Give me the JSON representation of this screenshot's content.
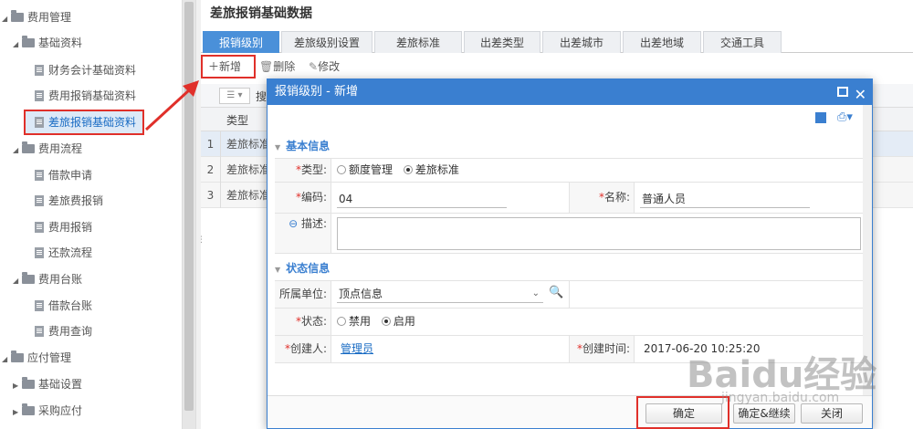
{
  "sidebar": {
    "items": [
      {
        "label": "费用管理"
      },
      {
        "label": "基础资料"
      },
      {
        "label": "财务会计基础资料"
      },
      {
        "label": "费用报销基础资料"
      },
      {
        "label": "差旅报销基础资料"
      },
      {
        "label": "费用流程"
      },
      {
        "label": "借款申请"
      },
      {
        "label": "差旅费报销"
      },
      {
        "label": "费用报销"
      },
      {
        "label": "还款流程"
      },
      {
        "label": "费用台账"
      },
      {
        "label": "借款台账"
      },
      {
        "label": "费用查询"
      },
      {
        "label": "应付管理"
      },
      {
        "label": "基础设置"
      },
      {
        "label": "采购应付"
      }
    ]
  },
  "main": {
    "title": "差旅报销基础数据",
    "tabs": [
      {
        "label": "报销级别"
      },
      {
        "label": "差旅级别设置"
      },
      {
        "label": "差旅标准"
      },
      {
        "label": "出差类型"
      },
      {
        "label": "出差城市"
      },
      {
        "label": "出差地域"
      },
      {
        "label": "交通工具"
      }
    ],
    "toolbar": {
      "add": "新增",
      "delete": "删除",
      "edit": "修改"
    },
    "grid": {
      "search_hint": "搜",
      "column": "类型",
      "rows": [
        {
          "num": "1",
          "type": "差旅标准"
        },
        {
          "num": "2",
          "type": "差旅标准"
        },
        {
          "num": "3",
          "type": "差旅标准"
        }
      ]
    }
  },
  "dialog": {
    "title": "报销级别 - 新增",
    "basic_section": "基本信息",
    "status_section": "状态信息",
    "fields": {
      "type_label": "类型:",
      "type_option1": "额度管理",
      "type_option2": "差旅标准",
      "code_label": "编码:",
      "code_value": "04",
      "name_label": "名称:",
      "name_value": "普通人员",
      "desc_label": "描述:",
      "unit_label": "所属单位:",
      "unit_value": "顶点信息",
      "state_label": "状态:",
      "state_option1": "禁用",
      "state_option2": "启用",
      "creator_label": "创建人:",
      "creator_value": "管理员",
      "created_time_label": "创建时间:",
      "created_time_value": "2017-06-20 10:25:20"
    },
    "buttons": {
      "ok": "确定",
      "ok_continue": "确定&继续",
      "close": "关闭"
    }
  },
  "watermark": {
    "text": "Baidu经验",
    "sub": "jingyan.baidu.com"
  },
  "colors": {
    "accent": "#3a7fd0",
    "tab_active": "#4a90d9",
    "highlight": "#e0302a"
  }
}
